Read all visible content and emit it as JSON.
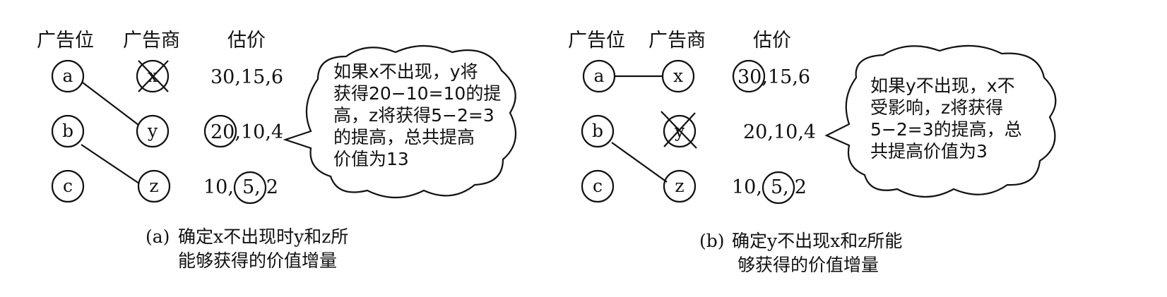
{
  "panel_a": {
    "headers": {
      "slot": "广告位",
      "advertiser": "广告商",
      "bid": "估价"
    },
    "slots": [
      "a",
      "b",
      "c"
    ],
    "advertisers": [
      "x",
      "y",
      "z"
    ],
    "bids": [
      {
        "v1": "30",
        "v2": "15",
        "v3": "6"
      },
      {
        "v1": "20",
        "v2": "10",
        "v3": "4"
      },
      {
        "v1": "10",
        "v2": "5",
        "v3": "2"
      }
    ],
    "note": [
      "如果x不出现，y将",
      "获得20−10=10的提",
      "高，z将获得5−2=3",
      "的提高，总共提高",
      "价值为13"
    ],
    "caption": {
      "label": "(a)",
      "line1": "确定x不出现时y和z所",
      "line2": "能够获得的价值增量"
    }
  },
  "panel_b": {
    "headers": {
      "slot": "广告位",
      "advertiser": "广告商",
      "bid": "估价"
    },
    "slots": [
      "a",
      "b",
      "c"
    ],
    "advertisers": [
      "x",
      "y",
      "z"
    ],
    "bids": [
      {
        "v1": "30",
        "v2": "15",
        "v3": "6"
      },
      {
        "v1": "20",
        "v2": "10",
        "v3": "4"
      },
      {
        "v1": "10",
        "v2": "5",
        "v3": "2"
      }
    ],
    "note": [
      "如果y不出现，x不",
      "受影响，z将获得",
      "5−2=3的提高，总",
      "共提高价值为3"
    ],
    "caption": {
      "label": "(b)",
      "line1": "确定y不出现x和z所能",
      "line2": "够获得的价值增量"
    }
  }
}
